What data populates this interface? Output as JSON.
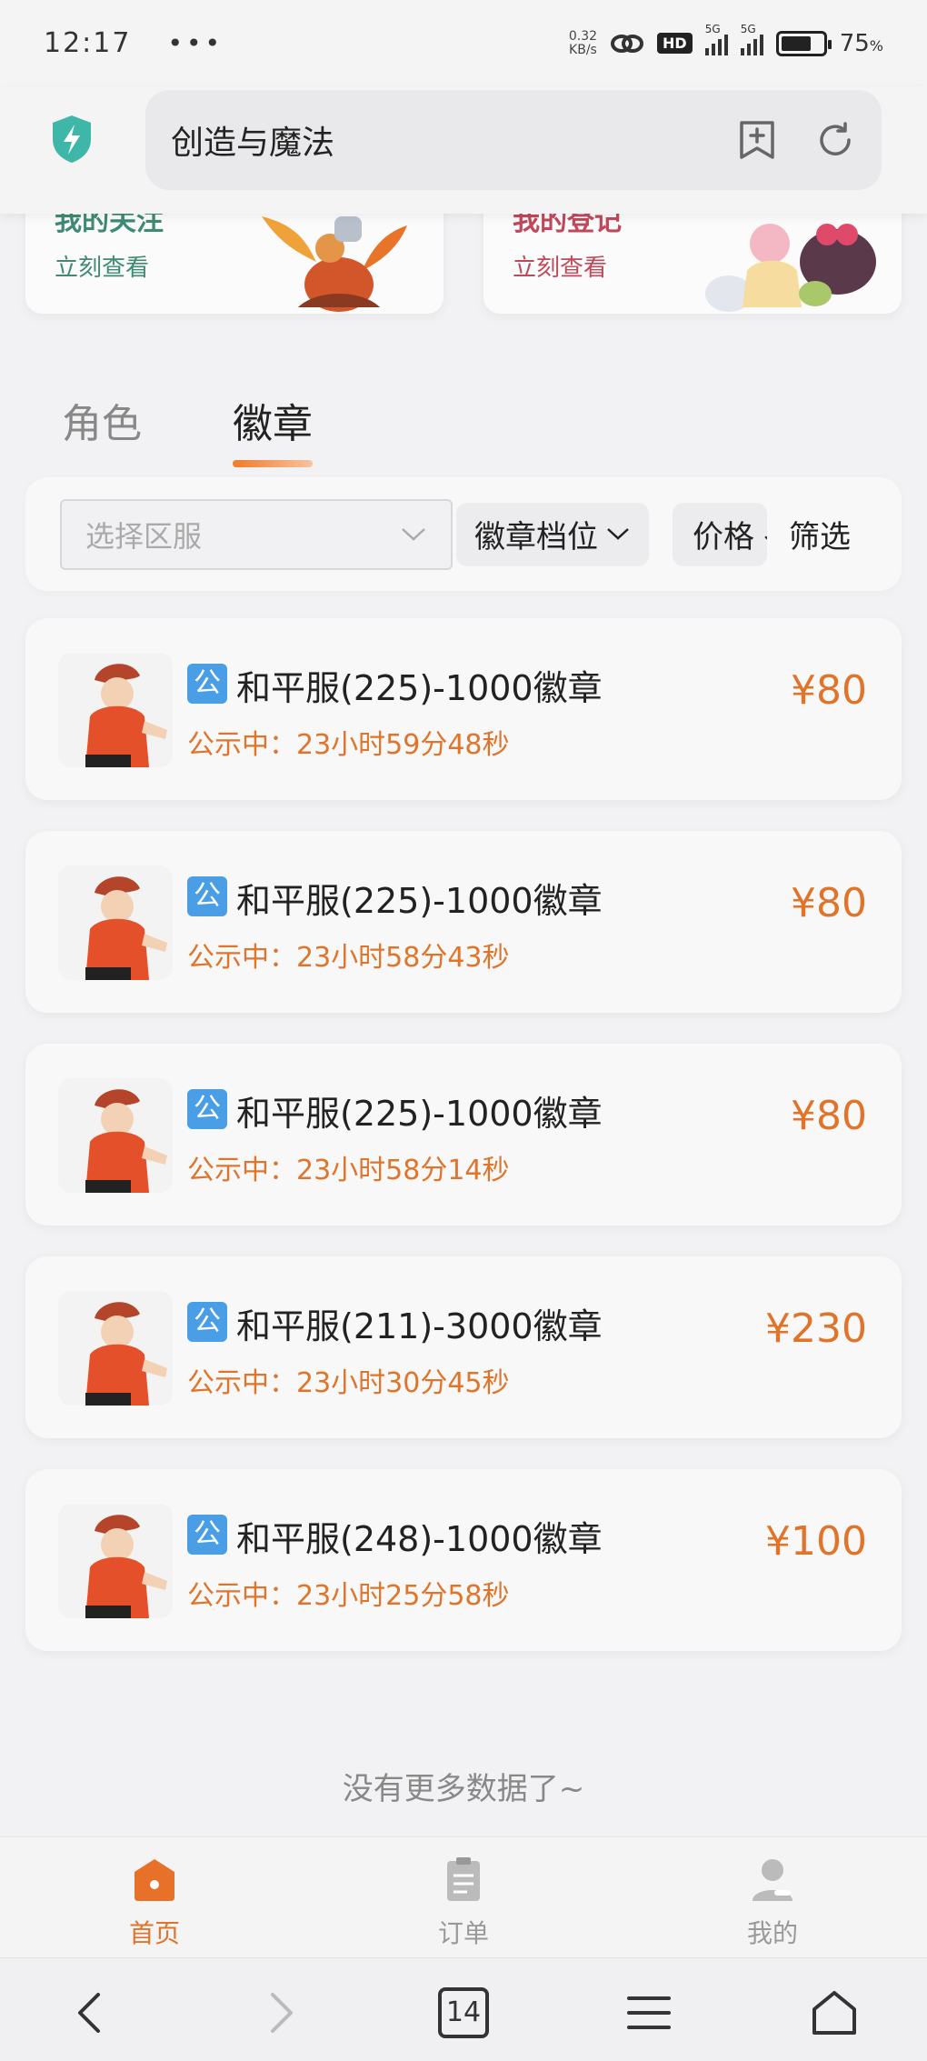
{
  "status_bar": {
    "time": "12:17",
    "net_speed_value": "0.32",
    "net_speed_unit": "KB/s",
    "hd_label": "HD",
    "signal1_label": "5G",
    "signal2_label": "5G",
    "battery": "75"
  },
  "browser": {
    "page_title": "创造与魔法"
  },
  "banners": {
    "left": {
      "title": "我的关注",
      "subtitle": "立刻查看"
    },
    "right": {
      "title": "我的登记",
      "subtitle": "立刻查看"
    }
  },
  "tabs": [
    {
      "label": "角色"
    },
    {
      "label": "徽章"
    }
  ],
  "filters": {
    "server_placeholder": "选择区服",
    "tier_label": "徽章档位",
    "price_label": "价格",
    "filter_label": "筛选"
  },
  "listings": [
    {
      "badge": "公",
      "name": "和平服(225)-1000徽章",
      "status": "公示中：23小时59分48秒",
      "price": "¥80"
    },
    {
      "badge": "公",
      "name": "和平服(225)-1000徽章",
      "status": "公示中：23小时58分43秒",
      "price": "¥80"
    },
    {
      "badge": "公",
      "name": "和平服(225)-1000徽章",
      "status": "公示中：23小时58分14秒",
      "price": "¥80"
    },
    {
      "badge": "公",
      "name": "和平服(211)-3000徽章",
      "status": "公示中：23小时30分45秒",
      "price": "¥230"
    },
    {
      "badge": "公",
      "name": "和平服(248)-1000徽章",
      "status": "公示中：23小时25分58秒",
      "price": "¥100"
    }
  ],
  "end_text": "没有更多数据了~",
  "bottom_nav": [
    {
      "label": "首页",
      "icon": "home-icon"
    },
    {
      "label": "订单",
      "icon": "order-icon"
    },
    {
      "label": "我的",
      "icon": "profile-icon"
    }
  ],
  "system_nav": {
    "tab_count": "14"
  },
  "colors": {
    "accent": "#e0742a",
    "badge_blue": "#4a9ee6"
  }
}
